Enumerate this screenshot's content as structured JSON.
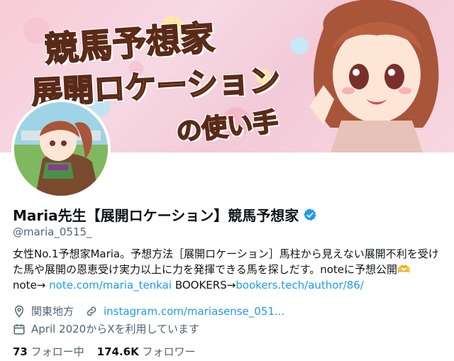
{
  "banner": {
    "line1": "競馬予想家",
    "line2": "展開ロケーション",
    "line3": "の使い手"
  },
  "profile": {
    "display_name": "Maria先生【展開ロケーション】競馬予想家",
    "handle": "@maria_0515_",
    "bio_text": "女性No.1予想家Maria。予想方法［展開ロケーション］馬柱から見えない展開不利を受けた馬や展開の恩恵受け実力以上に力を発揮できる馬を探しだす。noteに予想公開",
    "bio_note_label": "note→",
    "bio_note_link": "note.com/maria_tenkai",
    "bio_bookers_label": "BOOKERS→",
    "bio_bookers_link": "bookers.tech/author/86/",
    "location": "関東地方",
    "website": "instagram.com/mariasense_051...",
    "joined": "April 2020からXを利用しています",
    "following_count": "73",
    "following_label": "フォロー中",
    "followers_count": "174.6K",
    "followers_label": "フォロワー"
  },
  "colors": {
    "link": "#1d9bf0",
    "secondary_text": "#536471",
    "verified": "#1d9bf0"
  }
}
